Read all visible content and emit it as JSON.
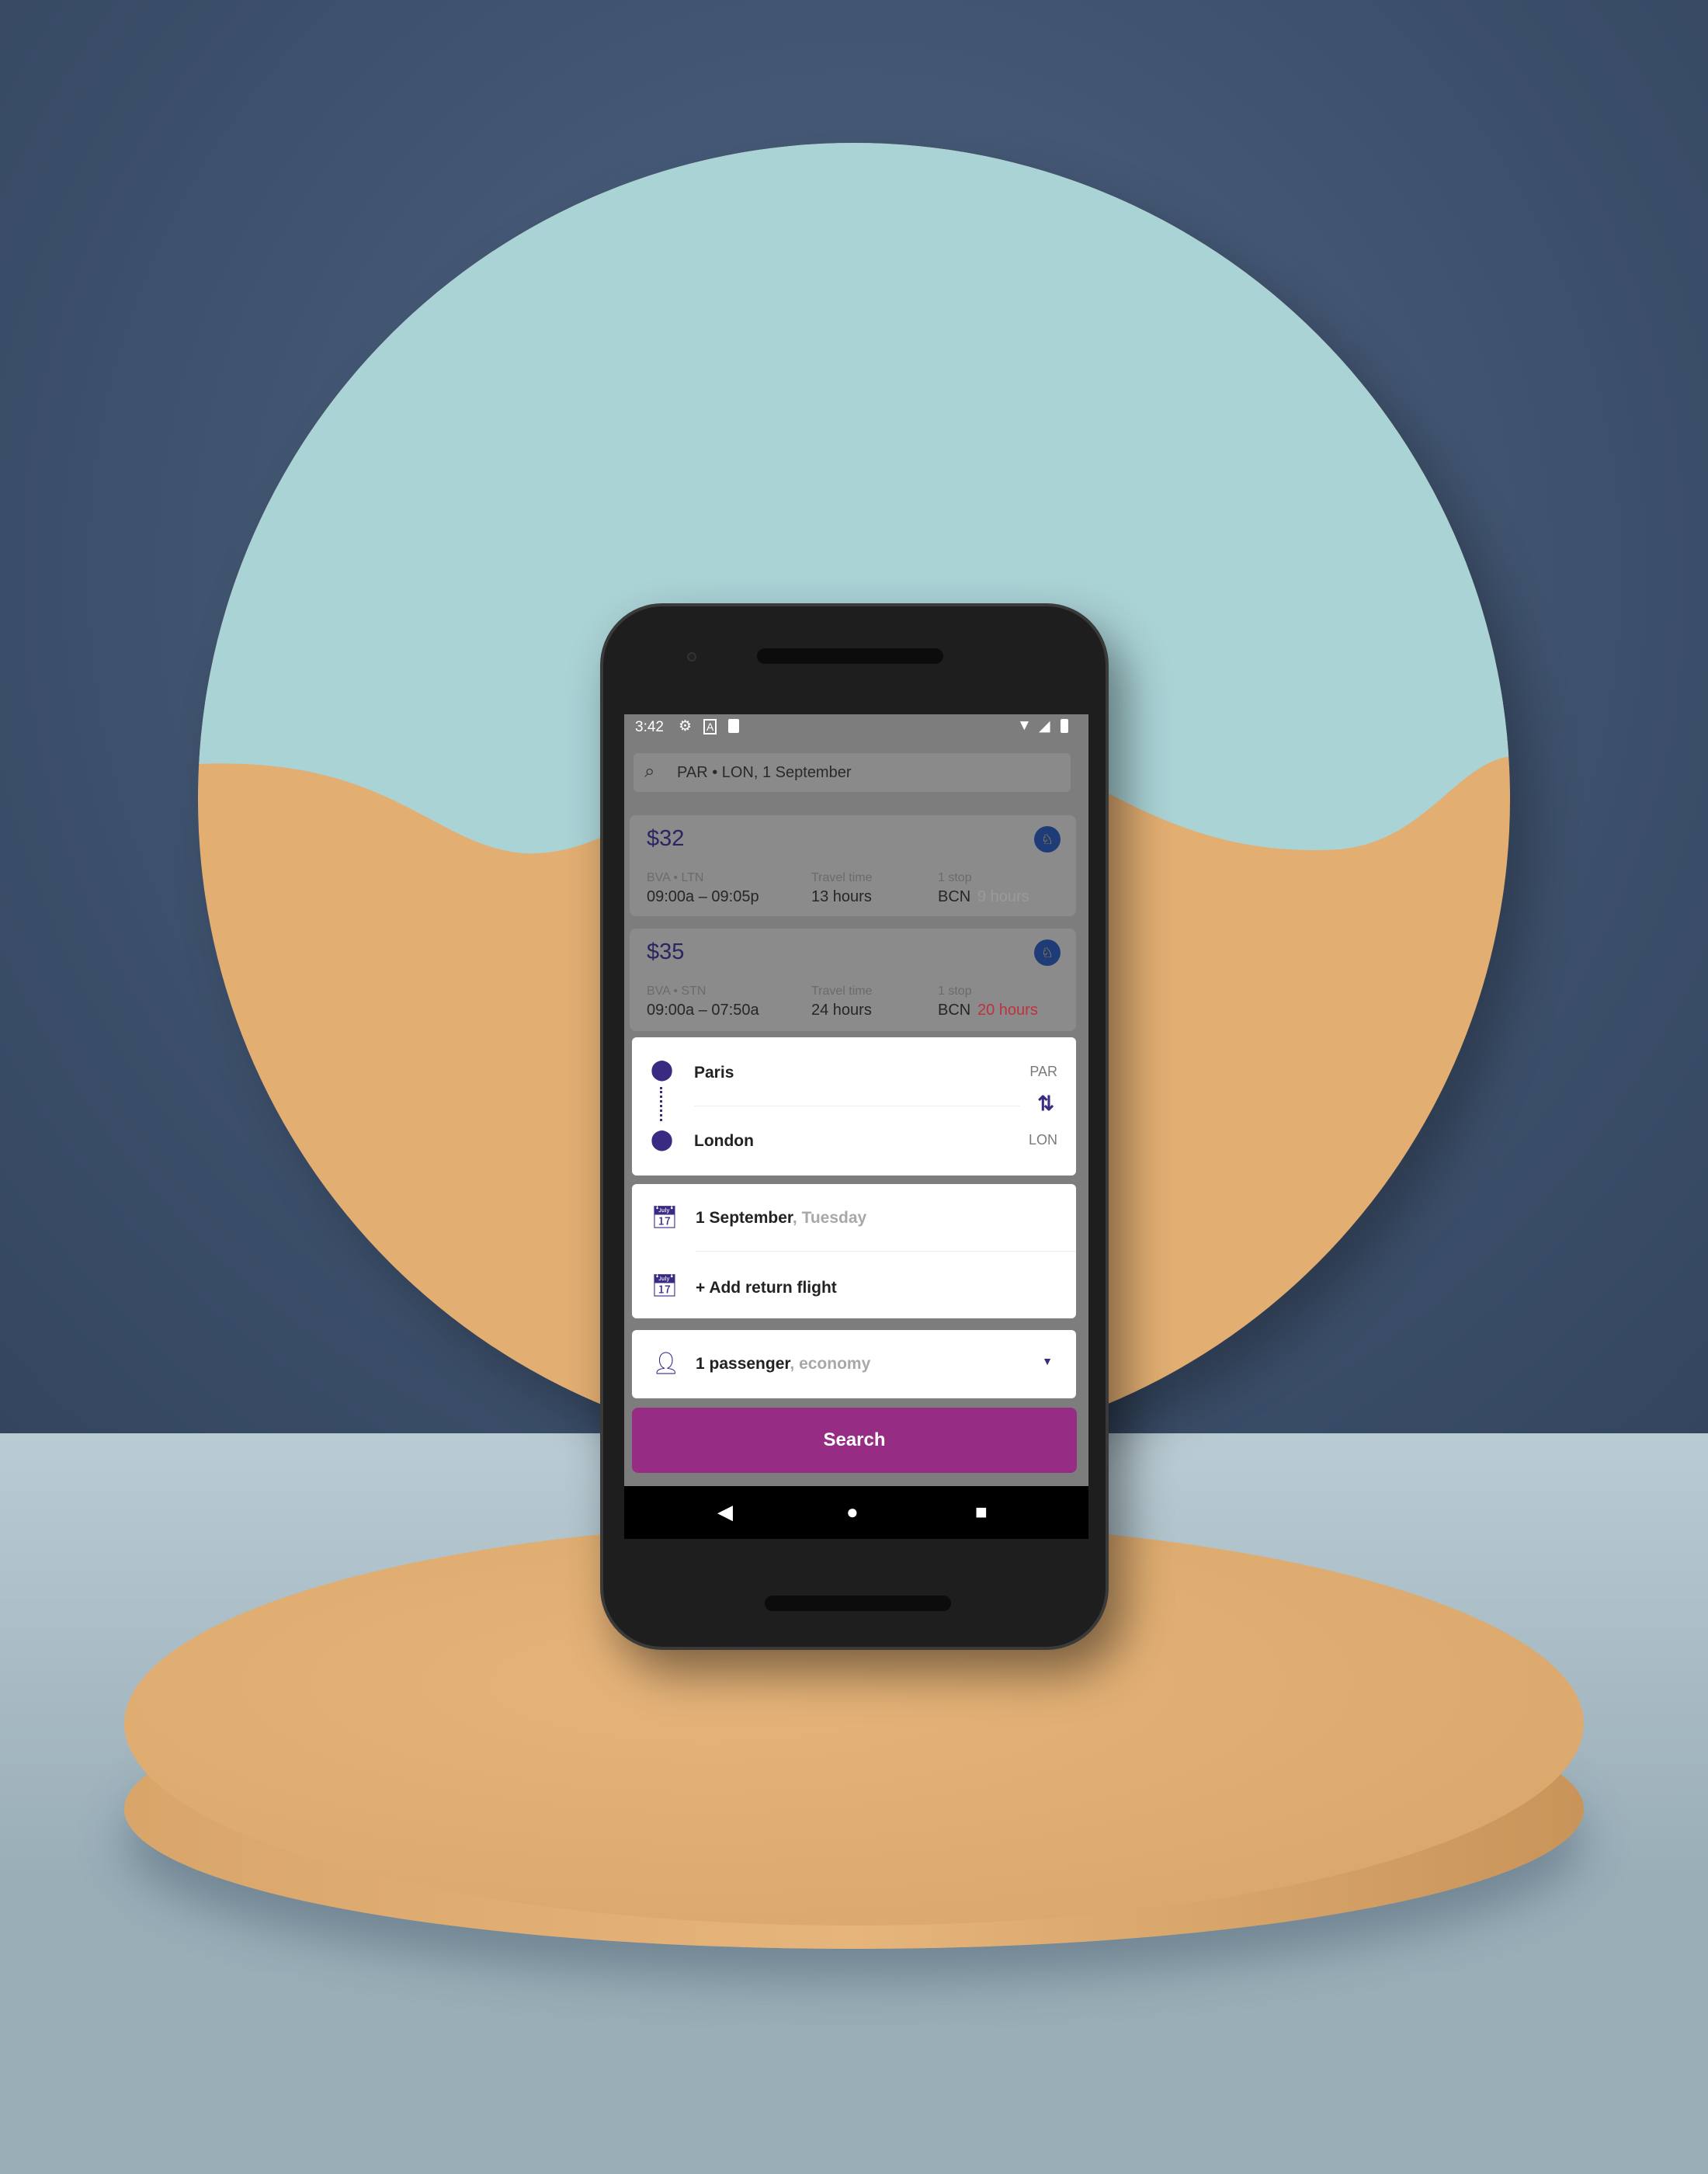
{
  "status_bar": {
    "time": "3:42"
  },
  "search_bar": {
    "query": "PAR • LON, 1 September"
  },
  "results": [
    {
      "price": "$32",
      "route": "BVA • LTN",
      "times": "09:00a – 09:05p",
      "travel_label": "Travel time",
      "travel": "13 hours",
      "stops_label": "1 stop",
      "via": "BCN",
      "layover": "9 hours",
      "layover_color": "#9a9a9a"
    },
    {
      "price": "$35",
      "route": "BVA • STN",
      "times": "09:00a – 07:50a",
      "travel_label": "Travel time",
      "travel": "24 hours",
      "stops_label": "1 stop",
      "via": "BCN",
      "layover": "20 hours",
      "layover_color": "#c0303e"
    }
  ],
  "form": {
    "from_city": "Paris",
    "from_code": "PAR",
    "to_city": "London",
    "to_code": "LON",
    "date": "1 September",
    "weekday": ", Tuesday",
    "return": "+ Add return flight",
    "passengers": "1 passenger",
    "cabin": ", economy",
    "search_label": "Search"
  },
  "colors": {
    "accent": "#962c84",
    "brand": "#3b2a82"
  }
}
